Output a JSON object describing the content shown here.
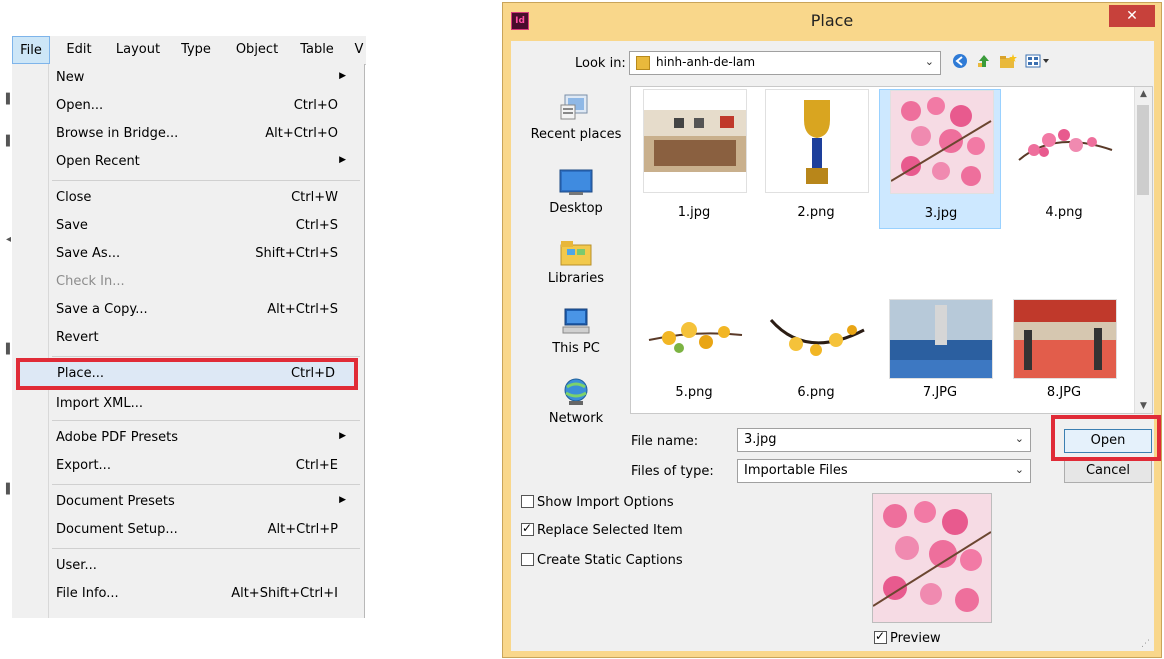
{
  "menubar": {
    "items": [
      {
        "label": "File",
        "active": true
      },
      {
        "label": "Edit"
      },
      {
        "label": "Layout"
      },
      {
        "label": "Type"
      },
      {
        "label": "Object"
      },
      {
        "label": "Table"
      },
      {
        "label": "V"
      }
    ]
  },
  "file_menu": {
    "items": [
      {
        "label": "New",
        "shortcut": "",
        "submenu": true
      },
      {
        "label": "Open...",
        "shortcut": "Ctrl+O"
      },
      {
        "label": "Browse in Bridge...",
        "shortcut": "Alt+Ctrl+O"
      },
      {
        "label": "Open Recent",
        "shortcut": "",
        "submenu": true
      },
      {
        "label": "Close",
        "shortcut": "Ctrl+W"
      },
      {
        "label": "Save",
        "shortcut": "Ctrl+S"
      },
      {
        "label": "Save As...",
        "shortcut": "Shift+Ctrl+S"
      },
      {
        "label": "Check In...",
        "shortcut": "",
        "disabled": true
      },
      {
        "label": "Save a Copy...",
        "shortcut": "Alt+Ctrl+S"
      },
      {
        "label": "Revert",
        "shortcut": ""
      },
      {
        "label": "Place...",
        "shortcut": "Ctrl+D",
        "highlighted": true
      },
      {
        "label": "Import XML...",
        "shortcut": ""
      },
      {
        "label": "Adobe PDF Presets",
        "shortcut": "",
        "submenu": true
      },
      {
        "label": "Export...",
        "shortcut": "Ctrl+E"
      },
      {
        "label": "Document Presets",
        "shortcut": "",
        "submenu": true
      },
      {
        "label": "Document Setup...",
        "shortcut": "Alt+Ctrl+P"
      },
      {
        "label": "User...",
        "shortcut": ""
      },
      {
        "label": "File Info...",
        "shortcut": "Alt+Shift+Ctrl+I"
      }
    ]
  },
  "dialog": {
    "title": "Place",
    "app_icon": "Id",
    "close_glyph": "✕",
    "look_in_label": "Look in:",
    "look_in_value": "hinh-anh-de-lam",
    "places": [
      {
        "label": "Recent places",
        "icon": "recent-places-icon"
      },
      {
        "label": "Desktop",
        "icon": "desktop-icon"
      },
      {
        "label": "Libraries",
        "icon": "libraries-icon"
      },
      {
        "label": "This PC",
        "icon": "this-pc-icon"
      },
      {
        "label": "Network",
        "icon": "network-icon"
      }
    ],
    "files": [
      {
        "name": "1.jpg"
      },
      {
        "name": "2.png"
      },
      {
        "name": "3.jpg",
        "selected": true
      },
      {
        "name": "4.png"
      },
      {
        "name": "5.png"
      },
      {
        "name": "6.png"
      },
      {
        "name": "7.JPG"
      },
      {
        "name": "8.JPG"
      }
    ],
    "file_name_label": "File name:",
    "file_name_value": "3.jpg",
    "files_of_type_label": "Files of type:",
    "files_of_type_value": "Importable Files",
    "open_button": "Open",
    "cancel_button": "Cancel",
    "options": {
      "show_import_options": {
        "label": "Show Import Options",
        "checked": false
      },
      "replace_selected_item": {
        "label": "Replace Selected Item",
        "checked": true
      },
      "create_static_captions": {
        "label": "Create Static Captions",
        "checked": false
      }
    },
    "preview_label": "Preview",
    "preview_checked": true
  },
  "colors": {
    "dialog_frame": "#f9d78b",
    "close_button": "#c7413b",
    "highlight_box": "#e02b37",
    "selection": "#cde8ff"
  }
}
